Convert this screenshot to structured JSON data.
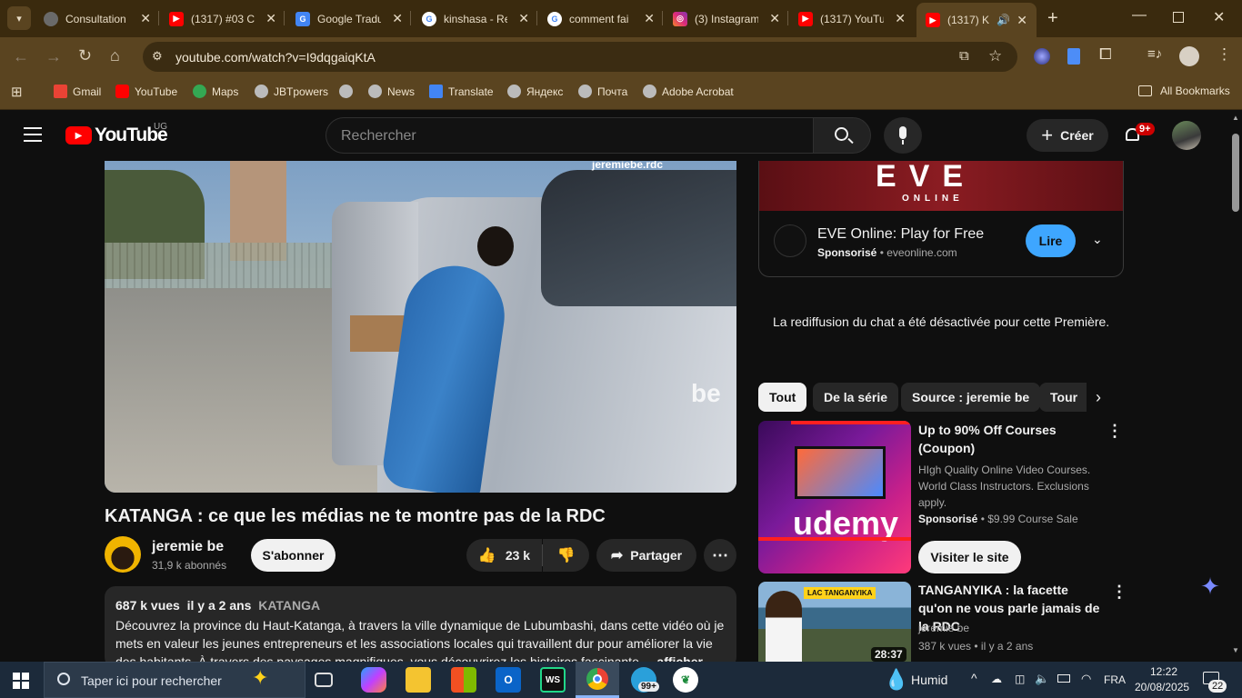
{
  "browser": {
    "tabs": [
      {
        "title": "Consultation",
        "favicon": "globe-icon",
        "color": "#6a6a6a"
      },
      {
        "title": "(1317) #03 C",
        "favicon": "youtube-icon",
        "color": "#ff0000"
      },
      {
        "title": "Google Tradu",
        "favicon": "translate-icon",
        "color": "#4285f4"
      },
      {
        "title": "kinshasa - Re",
        "favicon": "google-icon",
        "color": "#ffffff"
      },
      {
        "title": "comment fai",
        "favicon": "google-icon",
        "color": "#ffffff"
      },
      {
        "title": "(3) Instagram",
        "favicon": "instagram-icon",
        "color": "#d6249f"
      },
      {
        "title": "(1317) YouTu",
        "favicon": "youtube-icon",
        "color": "#ff0000"
      },
      {
        "title": "(1317) K",
        "favicon": "youtube-icon",
        "color": "#ff0000"
      }
    ],
    "url": "youtube.com/watch?v=I9dqgaiqKtA",
    "bookmarks": [
      {
        "label": "Gmail",
        "color": "#ea4335"
      },
      {
        "label": "YouTube",
        "color": "#ff0000"
      },
      {
        "label": "Maps",
        "color": "#34a853"
      },
      {
        "label": "JBTpowers",
        "color": "#bbbbbb"
      },
      {
        "label": "",
        "color": "#bbbbbb"
      },
      {
        "label": "News",
        "color": "#bbbbbb"
      },
      {
        "label": "Translate",
        "color": "#4285f4"
      },
      {
        "label": "Яндекс",
        "color": "#bbbbbb"
      },
      {
        "label": "Почта",
        "color": "#bbbbbb"
      },
      {
        "label": "Adobe Acrobat",
        "color": "#bbbbbb"
      }
    ],
    "all_bookmarks": "All Bookmarks"
  },
  "youtube": {
    "logo_text": "YouTube",
    "country": "UG",
    "search_placeholder": "Rechercher",
    "create_label": "Créer",
    "notif_count": "9+"
  },
  "video": {
    "watermark": "jeremiebe.rdc",
    "corner_mark": "be",
    "title": "KATANGA : ce que les médias ne te montre pas de la RDC",
    "channel": "jeremie be",
    "subscribers": "31,9 k abonnés",
    "subscribe_label": "S'abonner",
    "likes": "23 k",
    "share_label": "Partager",
    "views": "687 k vues",
    "age": "il y a 2 ans",
    "hashtag": "KATANGA",
    "description": "Découvrez la province du Haut-Katanga, à travers la ville dynamique de Lubumbashi, dans cette vidéo où je mets en valeur les jeunes entrepreneurs et les associations locales qui travaillent dur pour améliorer la vie des habitants. À travers des paysages magnifiques, vous découvrirez les histoires fascinante",
    "show_more": "...afficher plus"
  },
  "ad": {
    "banner_text": "EVE",
    "banner_sub": "ONLINE",
    "title": "EVE Online: Play for Free",
    "sponsored": "Sponsorisé",
    "domain": "eveonline.com",
    "cta": "Lire"
  },
  "chat_message": "La rediffusion du chat a été désactivée pour cette Première.",
  "chips": [
    "Tout",
    "De la série",
    "Source : jeremie be",
    "Tour"
  ],
  "recommendations": [
    {
      "title": "Up to 90% Off Courses (Coupon)",
      "desc": "HIgh Quality Online Video Courses. World Class Instructors. Exclusions apply.",
      "sponsored": "Sponsorisé",
      "price": "$9.99 Course Sale",
      "cta": "Visiter le site",
      "thumb_text": "udemy"
    },
    {
      "title": "TANGANYIKA : la facette qu'on ne vous parle jamais de la RDC",
      "channel": "jeremie be",
      "meta": "387 k vues • il y a 2 ans",
      "duration": "28:37",
      "thumb_label": "LAC TANGANYIKA"
    }
  ],
  "taskbar": {
    "search_placeholder": "Taper ici pour rechercher",
    "weather": "Humid",
    "lang": "FRA",
    "time": "12:22",
    "date": "20/08/2025",
    "notif_count": "22",
    "badge": "99+"
  }
}
